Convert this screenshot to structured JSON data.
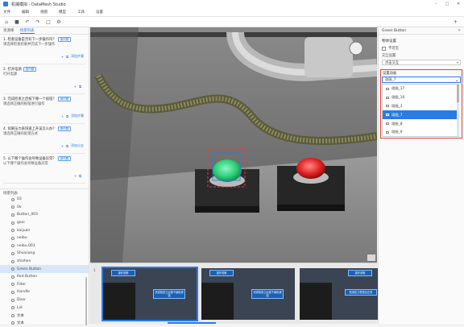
{
  "app": {
    "title": "机械模拟 - DataMesh Studio"
  },
  "menu": [
    "文件",
    "编辑",
    "视图",
    "模型",
    "工具",
    "设置"
  ],
  "toolbar": {
    "icons": [
      "home-icon",
      "save-icon",
      "undo-icon",
      "redo-icon",
      "export-icon",
      "settings-icon"
    ],
    "add": "+"
  },
  "left": {
    "tabs": [
      "资源库",
      "场景列表"
    ],
    "tasks": [
      {
        "title": "1. 检查设备是否有下一步操作吗？",
        "badge": "操作题",
        "desc": "请选择检查结果并完成下一步操作",
        "action": "添加步骤"
      },
      {
        "title": "2. 打开电源",
        "badge": "操作题",
        "desc": "打开电源",
        "action": ""
      },
      {
        "title": "3. 完成检查之后按下哪一个按钮？",
        "badge": "操作题",
        "desc": "请选择正确的按钮进行操作",
        "action": "添加步骤"
      },
      {
        "title": "4. 如果压力表快速上升该怎么办？",
        "badge": "操作题",
        "desc": "请选择正确的处理方式",
        "action": "添加分支"
      },
      {
        "title": "5. 以下哪个操作会导致设备异常？",
        "badge": "操作题",
        "desc": "以下哪个操作会导致设备异常",
        "action": ""
      }
    ],
    "tree_title": "场景列表",
    "tree": [
      "03",
      "0k",
      "Button_003",
      "gooi",
      "kaijuan",
      "neibu",
      "neibu.003",
      "Shuixiang",
      "zhizhen",
      "Green Button",
      "Red Button",
      "Filter",
      "Handle",
      "Door",
      "Lid",
      "文本",
      "文本"
    ],
    "selected_node": "Green Button"
  },
  "viewport": {
    "bg": "#6f6f6f",
    "green": "#2fd07a",
    "red": "#e42424"
  },
  "filmstrip": {
    "label": "1",
    "thumbs": [
      {
        "text_a": "操作说明",
        "text_b": "完成检查之后按下绿色按钮"
      },
      {
        "text_a": "操作说明",
        "text_b": "完成检查之后按下绿色按钮"
      },
      {
        "text_a": "操作说明",
        "text_b": "检测压力表是否正常"
      }
    ]
  },
  "right": {
    "header": "Green Button",
    "section1": "物体设置",
    "checkbox": "不可见",
    "label2": "交互设置",
    "select2": "点击交互",
    "label3": "设置动画",
    "select3": "动画_7",
    "options": [
      "动画_17",
      "动画_10",
      "动画_3",
      "动画_7",
      "动画_8",
      "动画_9"
    ],
    "selected_option": "动画_7",
    "accent": "#2a7be4",
    "highlight": "#e0443a"
  }
}
